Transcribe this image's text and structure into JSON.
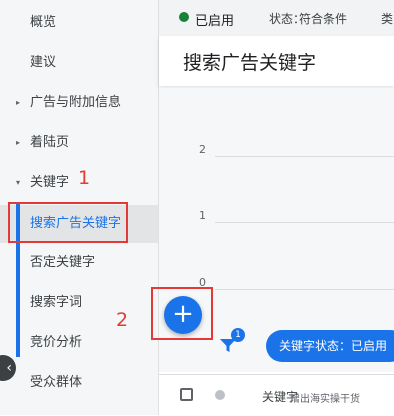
{
  "sidebar": {
    "items": [
      {
        "label": "概览"
      },
      {
        "label": "建议"
      },
      {
        "label": "广告与附加信息",
        "caret": "▸"
      },
      {
        "label": "着陆页",
        "caret": "▸"
      },
      {
        "label": "关键字",
        "caret": "▾"
      },
      {
        "label": "搜索广告关键字"
      },
      {
        "label": "否定关键字"
      },
      {
        "label": "搜索字词"
      },
      {
        "label": "竞价分析"
      },
      {
        "label": "受众群体"
      }
    ],
    "collapse_glyph": "‹"
  },
  "topbar": {
    "status": "已启用",
    "status_label": "状态：",
    "status_value": "符合条件",
    "extra": "类"
  },
  "header": {
    "title": "搜索广告关键字"
  },
  "chart_data": {
    "type": "line",
    "y_ticks": [
      "2",
      "1",
      "0"
    ],
    "ylim": [
      0,
      2
    ],
    "series": []
  },
  "toolbar": {
    "fab_glyph": "+",
    "filter_badge": "1",
    "filter_chip": "关键字状态：已启用"
  },
  "table": {
    "column_label": "关键字",
    "watermark": "增出海实操干货"
  },
  "annotations": {
    "first": "1",
    "second": "2"
  },
  "colors": {
    "accent": "#1a73e8",
    "status_green": "#188038",
    "annotation_red": "#e53935"
  }
}
